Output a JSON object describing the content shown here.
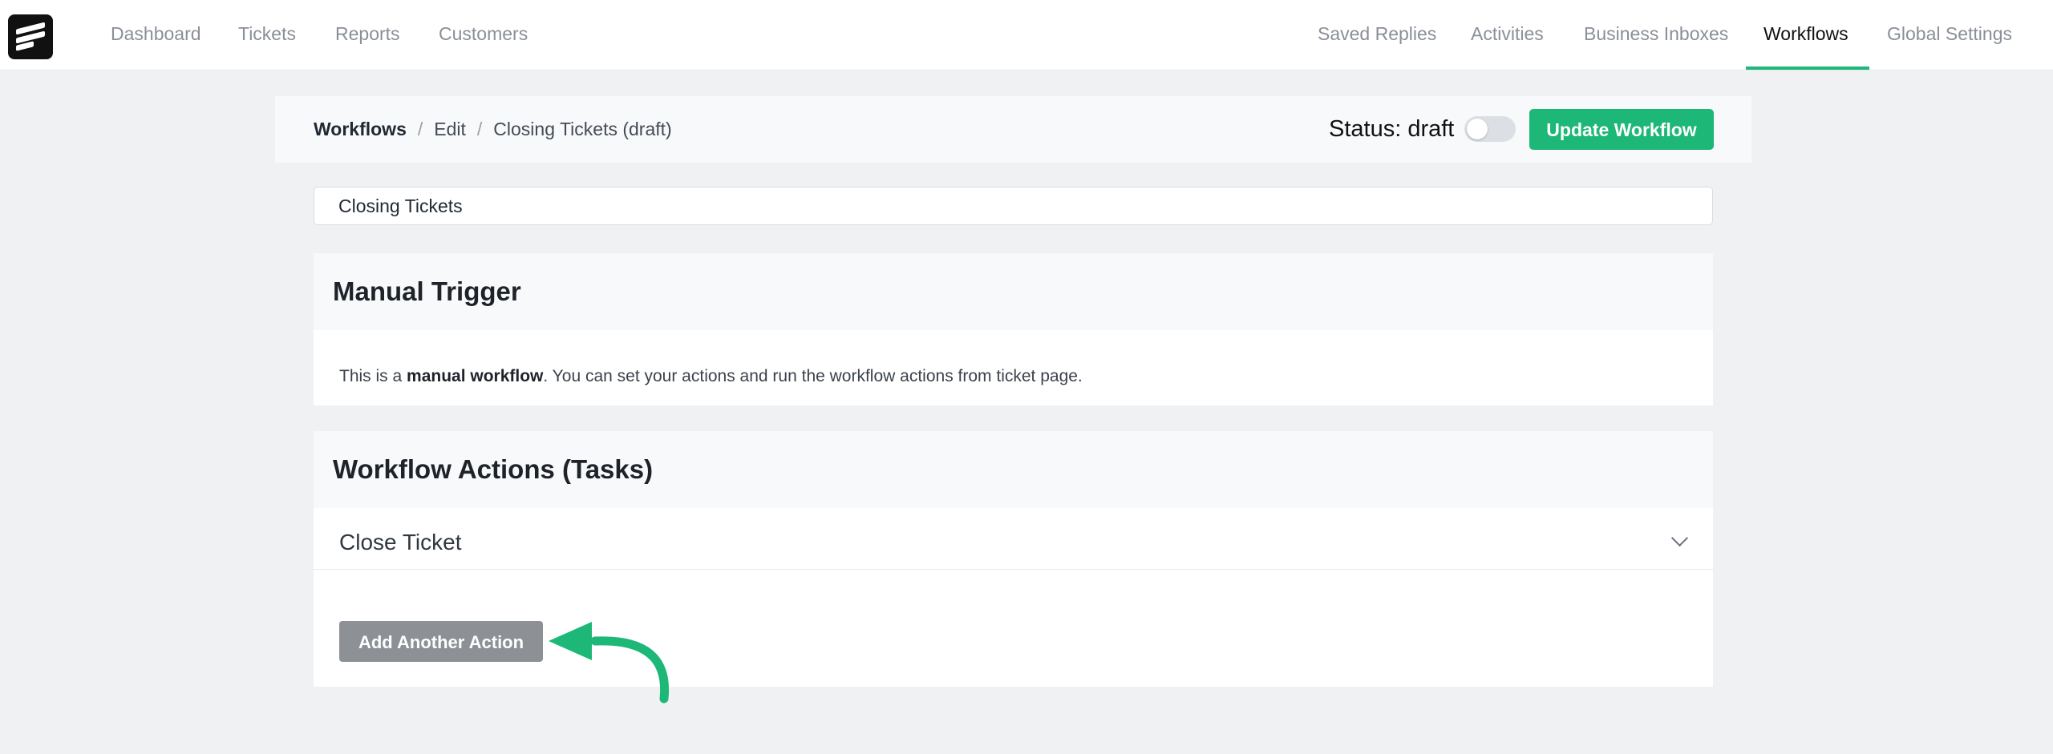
{
  "nav": {
    "left": [
      "Dashboard",
      "Tickets",
      "Reports",
      "Customers"
    ],
    "right": [
      "Saved Replies",
      "Activities",
      "Business Inboxes",
      "Workflows",
      "Global Settings"
    ],
    "active": "Workflows"
  },
  "breadcrumb": {
    "root": "Workflows",
    "separator": "/",
    "edit": "Edit",
    "current": "Closing Tickets (draft)"
  },
  "status": {
    "label": "Status: draft",
    "toggle_on": false
  },
  "buttons": {
    "update": "Update Workflow",
    "add_action": "Add Another Action"
  },
  "workflow_title": {
    "value": "Closing Tickets"
  },
  "trigger": {
    "heading": "Manual Trigger",
    "text_before": "This is a ",
    "text_bold": "manual workflow",
    "text_after": ". You can set your actions and run the workflow actions from ticket page."
  },
  "actions": {
    "heading": "Workflow Actions (Tasks)",
    "items": [
      {
        "label": "Close Ticket"
      }
    ]
  },
  "colors": {
    "accent": "#1db777",
    "annotation_arrow": "#1db777",
    "secondary_button": "#8d9196"
  },
  "icons": {
    "logo": "fluent-support-logo-icon",
    "expand": "chevron-down-icon",
    "annotation": "curved-arrow-icon"
  }
}
